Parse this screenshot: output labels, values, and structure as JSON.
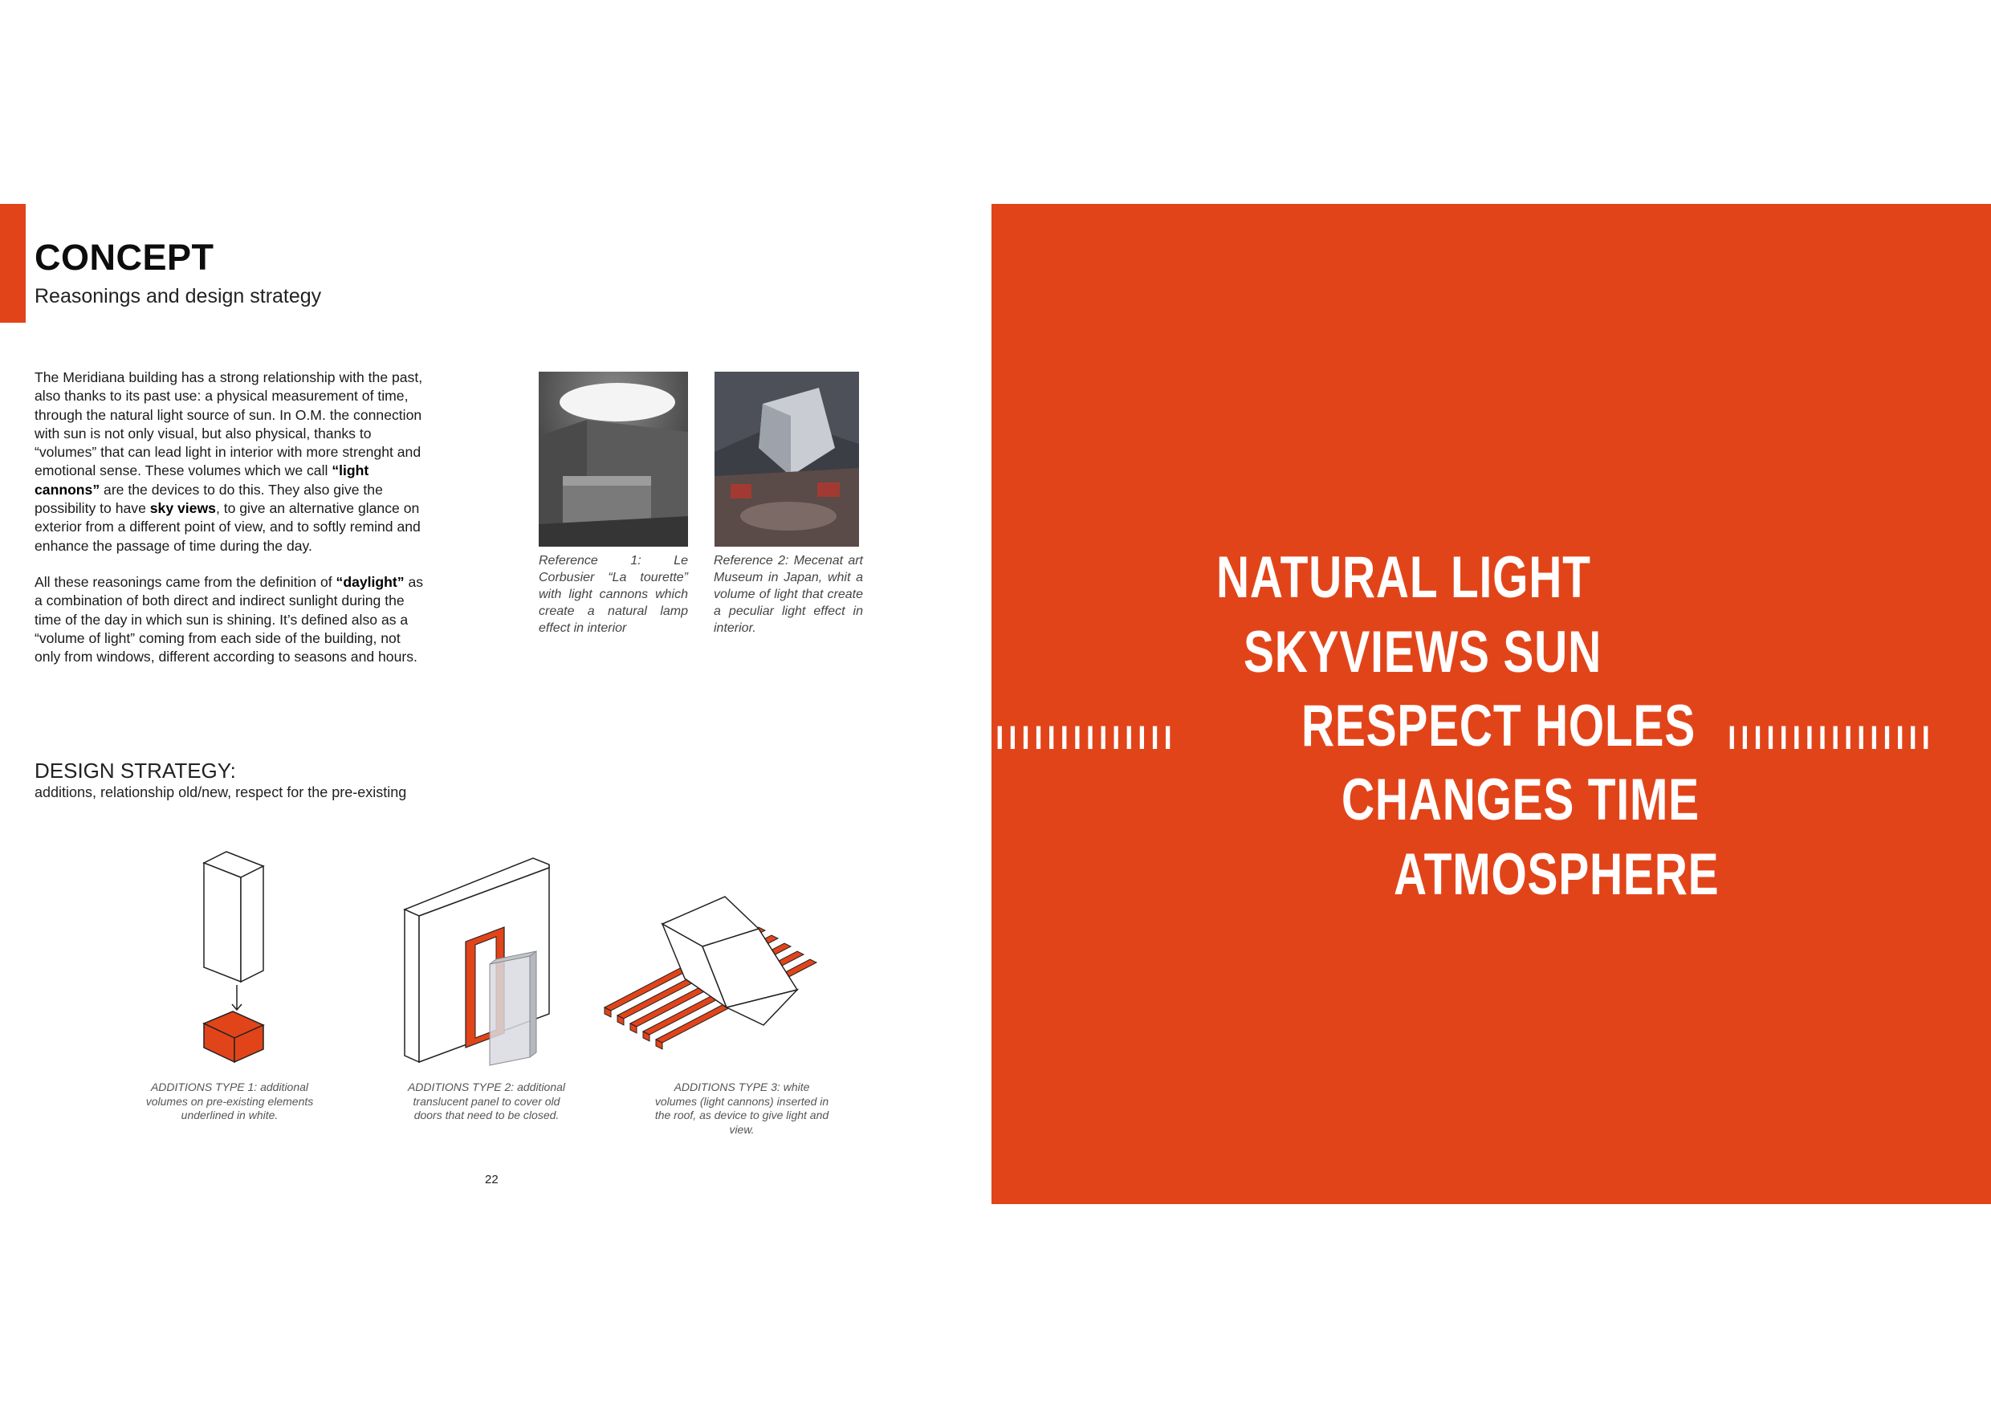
{
  "header": {
    "title": "CONCEPT",
    "subtitle": "Reasonings and design strategy"
  },
  "body": {
    "p1_a": "The Meridiana building has a strong relationship with the past, also thanks to its past use: a physical measurement of time, through the natural light source of sun. In O.M. the connection with sun is not only visual, but also physical, thanks to “volumes” that can lead light in interior with more strenght and emotional sense. These volumes which we call ",
    "p1_b": "“light cannons”",
    "p1_c": " are the devices to do this. They also give the possibility to have ",
    "p1_d": "sky views",
    "p1_e": ", to give an alternative glance on exterior from a different point of view, and to softly remind and enhance the passage of time during the day.",
    "p2_a": "All these reasonings came from the definition of ",
    "p2_b": "“daylight”",
    "p2_c": " as a combination of both direct and indirect sunlight during the time of the day in which sun is shining. It’s defined also as a “volume of light” coming from each side of the building, not only from windows, different according to seasons and hours."
  },
  "references": [
    {
      "caption": "Reference 1: Le Corbusier “La tourette” with light cannons which create a natural lamp effect in interior"
    },
    {
      "caption": "Reference 2: Mecenat art Museum in Japan, whit a volume of light that create a peculiar light effect in interior."
    }
  ],
  "design_strategy": {
    "title": "DESIGN STRATEGY:",
    "subtitle": "additions, relationship old/new, respect for the pre-existing"
  },
  "diagrams": [
    {
      "caption": "ADDITIONS TYPE 1: additional volumes on pre-existing elements underlined in white."
    },
    {
      "caption": "ADDITIONS TYPE 2: additional translucent panel to cover old doors that need to be closed."
    },
    {
      "caption": "ADDITIONS TYPE 3: white volumes (light cannons) inserted in the roof, as device to give light and view."
    }
  ],
  "page_number": "22",
  "panel": {
    "words": [
      "NATURAL LIGHT",
      "SKYVIEWS SUN",
      "RESPECT HOLES",
      "CHANGES  TIME",
      "ATMOSPHERE"
    ],
    "ticks_left": "ıııııııııııııı",
    "ticks_right": "ıııııııııııııııı"
  },
  "colors": {
    "accent": "#e2441a",
    "text": "#1a1a1a"
  }
}
